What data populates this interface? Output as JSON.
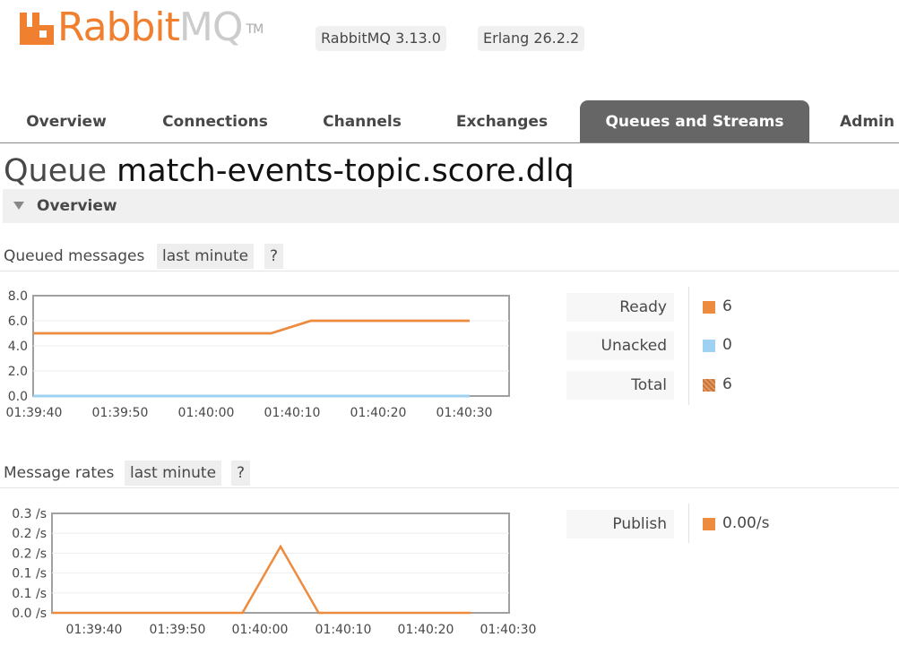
{
  "header": {
    "logo_text_a": "Rabbit",
    "logo_text_b": "MQ",
    "logo_tm": "TM",
    "rabbitmq_version": "RabbitMQ 3.13.0",
    "erlang_version": "Erlang 26.2.2"
  },
  "tabs": [
    {
      "label": "Overview",
      "active": false
    },
    {
      "label": "Connections",
      "active": false
    },
    {
      "label": "Channels",
      "active": false
    },
    {
      "label": "Exchanges",
      "active": false
    },
    {
      "label": "Queues and Streams",
      "active": true
    },
    {
      "label": "Admin",
      "active": false
    }
  ],
  "page": {
    "title_prefix": "Queue",
    "queue_name": "match-events-topic.score.dlq"
  },
  "section": {
    "label": "Overview"
  },
  "colors": {
    "accent": "#f07f2f",
    "ready": "#ed8b3f",
    "unacked": "#9fd1f2",
    "total": "#c8743a",
    "publish": "#ed8b3f",
    "tab_active_bg": "#666666"
  },
  "queued_messages": {
    "label": "Queued messages",
    "range_button": "last minute",
    "help_button": "?",
    "legend": [
      {
        "label": "Ready",
        "value": "6",
        "color": "#ed8b3f"
      },
      {
        "label": "Unacked",
        "value": "0",
        "color": "#9fd1f2"
      },
      {
        "label": "Total",
        "value": "6",
        "color": "#c8743a"
      }
    ]
  },
  "message_rates": {
    "label": "Message rates",
    "range_button": "last minute",
    "help_button": "?",
    "legend": [
      {
        "label": "Publish",
        "value": "0.00/s",
        "color": "#ed8b3f"
      }
    ]
  },
  "chart_data": [
    {
      "type": "line",
      "title": "Queued messages",
      "ylim": [
        0,
        8
      ],
      "y_ticks": [
        "8.0",
        "6.0",
        "4.0",
        "2.0",
        "0.0"
      ],
      "x_ticks": [
        "01:39:40",
        "01:39:50",
        "01:40:00",
        "01:40:10",
        "01:40:20",
        "01:40:30"
      ],
      "x_seconds": [
        0,
        25,
        30,
        35,
        55
      ],
      "series": [
        {
          "name": "Ready",
          "color": "#ed8b3f",
          "values": [
            5,
            5,
            5,
            6,
            6
          ]
        },
        {
          "name": "Unacked",
          "color": "#9fd1f2",
          "values": [
            0,
            0,
            0,
            0,
            0
          ]
        },
        {
          "name": "Total",
          "color": "#c8743a",
          "values": [
            5,
            5,
            5,
            6,
            6
          ]
        }
      ]
    },
    {
      "type": "line",
      "title": "Message rates",
      "ylim": [
        0,
        0.3
      ],
      "y_ticks": [
        "0.3 /s",
        "0.2 /s",
        "0.2 /s",
        "0.1 /s",
        "0.1 /s",
        "0.0 /s"
      ],
      "x_ticks": [
        "01:39:40",
        "01:39:50",
        "01:40:00",
        "01:40:10",
        "01:40:20",
        "01:40:30"
      ],
      "x_seconds": [
        0,
        25,
        30,
        35,
        55
      ],
      "series": [
        {
          "name": "Publish",
          "color": "#ed8b3f",
          "values": [
            0,
            0,
            0.2,
            0,
            0
          ]
        }
      ]
    }
  ]
}
